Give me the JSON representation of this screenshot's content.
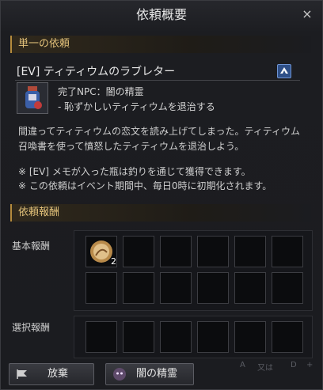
{
  "window": {
    "title": "依頼概要",
    "close_icon": "×"
  },
  "section_single": {
    "label": "単一の依頼"
  },
  "quest": {
    "title": "[EV] ティティウムのラブレター",
    "npc_line": "完了NPC：闇の精霊",
    "objective_line": "- 恥ずかしいティティウムを退治する",
    "description": [
      "間違ってティティウムの恋文を読み上げてしまった。ティティウム",
      "召喚書を使って憤怒したティティウムを退治しよう。"
    ],
    "notes": [
      "※ [EV] メモが入った瓶は釣りを通じて獲得できます。",
      "※ この依頼はイベント期間中、毎日0時に初期化されます。"
    ]
  },
  "rewards": {
    "section_label": "依頼報酬",
    "basic_label": "基本報酬",
    "choice_label": "選択報酬",
    "basic_item_count": "2"
  },
  "footer": {
    "abandon_label": "放棄",
    "spirit_label": "闇の精霊",
    "hint_key_a": "A",
    "hint_or": "又は",
    "hint_key_d": "D",
    "hint_plus": "+"
  }
}
